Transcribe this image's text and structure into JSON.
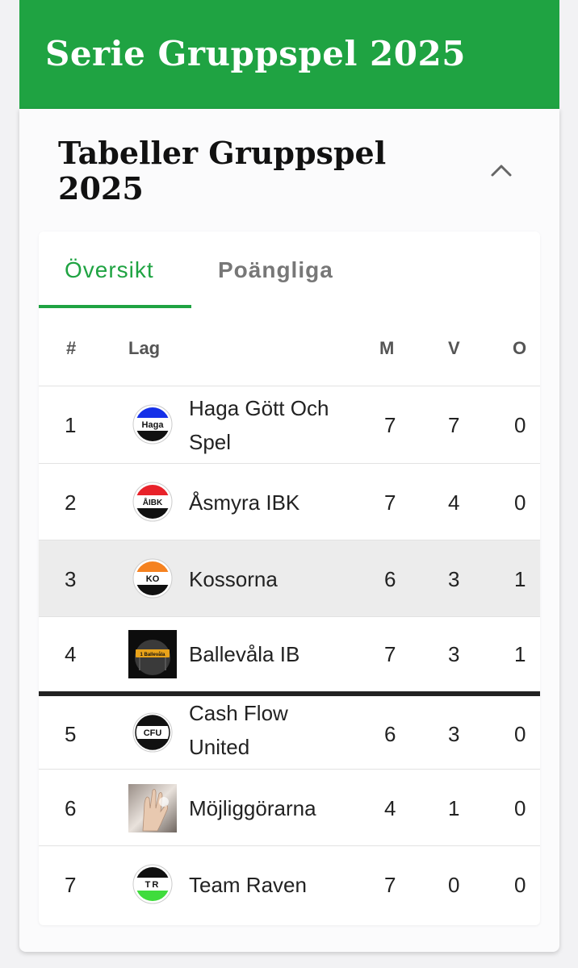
{
  "header": {
    "title": "Serie Gruppspel 2025"
  },
  "card": {
    "title": "Tabeller Gruppspel 2025",
    "collapse_icon": "chevron-up-icon"
  },
  "tabs": [
    {
      "label": "Översikt",
      "active": true
    },
    {
      "label": "Poängliga",
      "active": false
    }
  ],
  "table": {
    "headers": {
      "rank": "#",
      "team": "Lag",
      "m": "M",
      "v": "V",
      "o": "O"
    },
    "rows": [
      {
        "rank": "1",
        "team": "Haga Gött Och Spel",
        "logo_text": "Haga",
        "m": "7",
        "v": "7",
        "o": "0"
      },
      {
        "rank": "2",
        "team": "Åsmyra IBK",
        "logo_text": "ÅIBK",
        "m": "7",
        "v": "4",
        "o": "0"
      },
      {
        "rank": "3",
        "team": "Kossorna",
        "logo_text": "KO",
        "m": "6",
        "v": "3",
        "o": "1"
      },
      {
        "rank": "4",
        "team": "Ballevåla IB",
        "logo_text": "1 Ballevåla",
        "m": "7",
        "v": "3",
        "o": "1"
      },
      {
        "rank": "5",
        "team": "Cash Flow United",
        "logo_text": "CFU",
        "m": "6",
        "v": "3",
        "o": "0"
      },
      {
        "rank": "6",
        "team": "Möjliggörarna",
        "logo_text": "",
        "m": "4",
        "v": "1",
        "o": "0"
      },
      {
        "rank": "7",
        "team": "Team Raven",
        "logo_text": "TR",
        "m": "7",
        "v": "0",
        "o": "0"
      }
    ]
  },
  "colors": {
    "brand_green": "#1fa342",
    "haga_top": "#1530e8",
    "aibk_top": "#e8222a",
    "ko_top": "#f58220",
    "cfu_top": "#ffffff",
    "tr_bottom": "#3fdc3c"
  }
}
